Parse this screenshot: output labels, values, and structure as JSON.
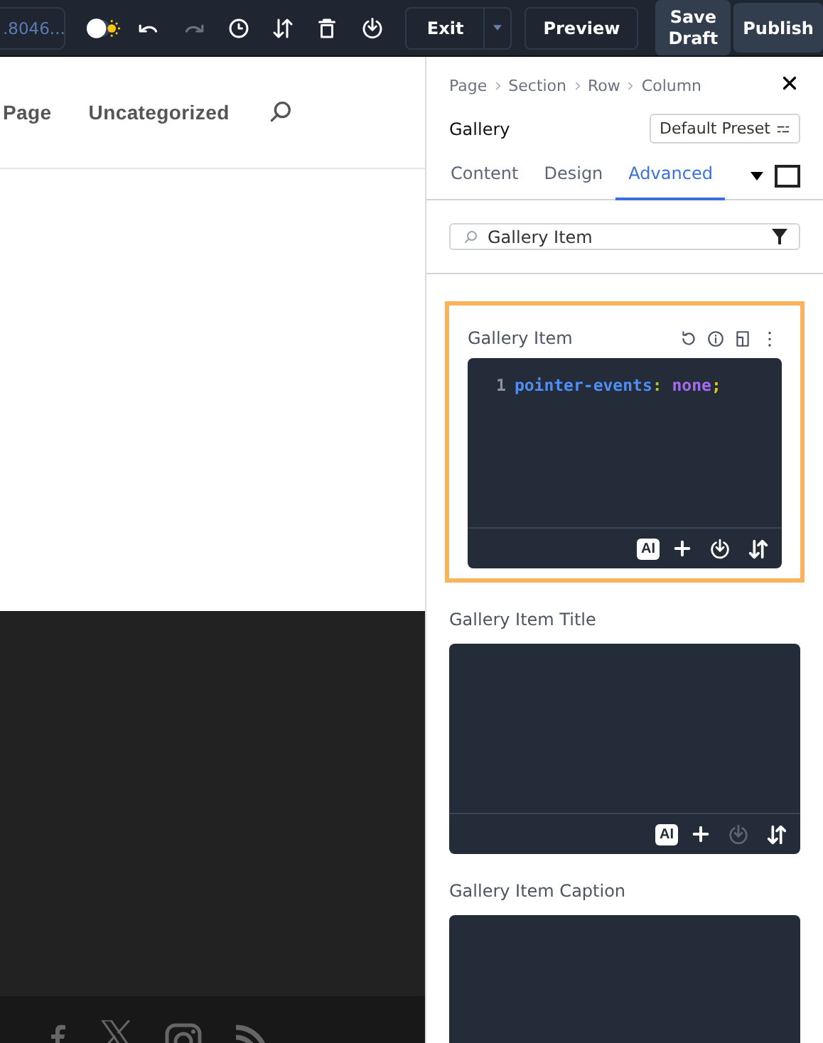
{
  "toolbar": {
    "url_field": ".8046...",
    "history": [
      {
        "kind": "undo",
        "disabled": false
      },
      {
        "kind": "redo",
        "disabled": true
      }
    ],
    "exit": "Exit",
    "preview": "Preview",
    "save_draft": "Save Draft",
    "publish": "Publish"
  },
  "canvas": {
    "nav_items": [
      "Page",
      "Uncategorized"
    ]
  },
  "panel": {
    "breadcrumbs": [
      "Page",
      "Section",
      "Row",
      "Column"
    ],
    "title": "Gallery",
    "preset": "Default Preset",
    "tabs": [
      {
        "label": "Content",
        "selected": false
      },
      {
        "label": "Design",
        "selected": false
      },
      {
        "label": "Advanced",
        "selected": true
      }
    ],
    "filter": {
      "value": "Gallery Item"
    },
    "css_fields": [
      {
        "label": "Gallery Item",
        "selected": true,
        "lines": [
          {
            "number": "1",
            "tokens": [
              {
                "kind": "property",
                "text": "pointer-events"
              },
              {
                "kind": "punct",
                "text": ": "
              },
              {
                "kind": "value",
                "text": "none"
              },
              {
                "kind": "end",
                "text": ";"
              }
            ]
          }
        ],
        "toolbar": {
          "ai_label": "AI",
          "clear_disabled": false
        }
      },
      {
        "label": "Gallery Item Title",
        "selected": false,
        "toolbar": {
          "ai_label": "AI",
          "clear_disabled": true
        }
      },
      {
        "label": "Gallery Item Caption",
        "selected": false
      }
    ]
  }
}
